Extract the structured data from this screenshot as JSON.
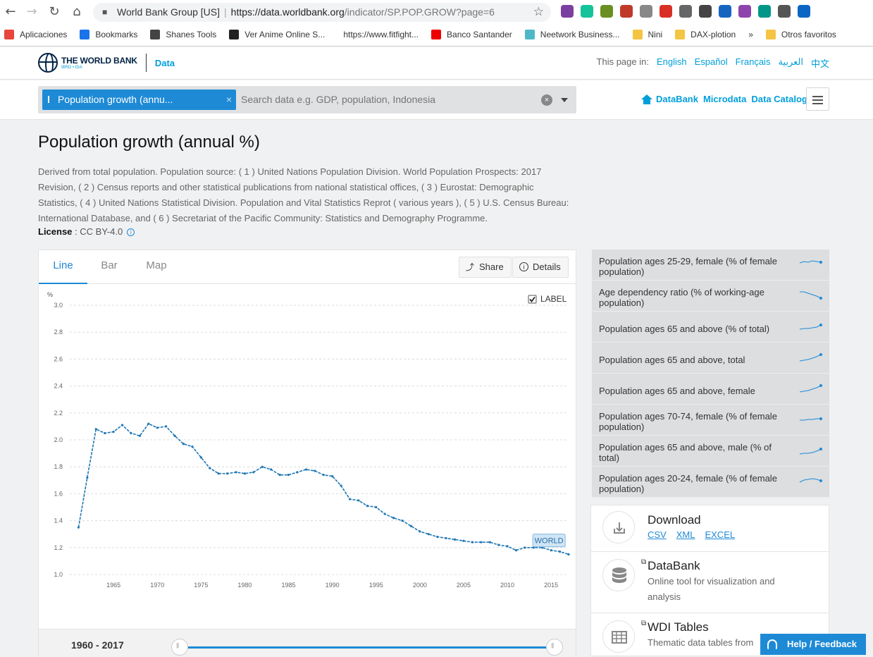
{
  "browser": {
    "tab_title": "World Bank Group [US]",
    "url_host": "https://data.worldbank.org",
    "url_path": "/indicator/SP.POP.GROW?page=6",
    "bookmarks": [
      {
        "label": "Aplicaciones",
        "color": "#e8453c"
      },
      {
        "label": "Bookmarks",
        "color": "#1a73e8"
      },
      {
        "label": "Shanes Tools",
        "color": "#444444"
      },
      {
        "label": "Ver Anime Online S...",
        "color": "#222222"
      },
      {
        "label": "https://www.fitfight...",
        "color": "#ffffff"
      },
      {
        "label": "Banco Santander",
        "color": "#ec0000"
      },
      {
        "label": "Neetwork Business...",
        "color": "#4fb8c8"
      },
      {
        "label": "Nini",
        "color": "#f4c542"
      },
      {
        "label": "DAX-plotion",
        "color": "#f4c542"
      }
    ],
    "bookmarks_more": "»",
    "bookmarks_other": "Otros favoritos",
    "ext_colors": [
      "#7b3fa0",
      "#15c39a",
      "#6b8e23",
      "#c0392b",
      "#888888",
      "#d93025",
      "#666666",
      "#444444",
      "#1565c0",
      "#8e44ad",
      "#009688",
      "#555555",
      "#0a66c2"
    ]
  },
  "header": {
    "logo_line1": "THE WORLD BANK",
    "logo_line2": "IBRD • IDA",
    "section": "Data",
    "lang_label": "This page in:",
    "languages": [
      "English",
      "Español",
      "Français",
      "العربية",
      "中文"
    ]
  },
  "search": {
    "chip_label": "Population growth (annu...",
    "chip_close": "×",
    "placeholder": "Search data e.g. GDP, population, Indonesia",
    "links": [
      "DataBank",
      "Microdata",
      "Data Catalog"
    ]
  },
  "page": {
    "title": "Population growth (annual %)",
    "description": "Derived from total population. Population source: ( 1 ) United Nations Population Division. World Population Prospects: 2017 Revision, ( 2 ) Census reports and other statistical publications from national statistical offices, ( 3 ) Eurostat: Demographic Statistics, ( 4 ) United Nations Statistical Division. Population and Vital Statistics Reprot ( various years ), ( 5 ) U.S. Census Bureau: International Database, and ( 6 ) Secretariat of the Pacific Community: Statistics and Demography Programme.",
    "license_label": "License",
    "license_value": " : CC BY-4.0"
  },
  "chart_panel": {
    "tabs": [
      "Line",
      "Bar",
      "Map"
    ],
    "active_tab": "Line",
    "share_label": "Share",
    "details_label": "Details",
    "label_toggle": "LABEL",
    "label_checked": true,
    "range_start": "1960",
    "range_sep": " - ",
    "range_end": "2017"
  },
  "chart_data": {
    "type": "line",
    "ylabel": "%",
    "ylim": [
      1.0,
      3.0
    ],
    "yticks": [
      "1.0",
      "1.2",
      "1.4",
      "1.6",
      "1.8",
      "2.0",
      "2.2",
      "2.4",
      "2.6",
      "2.8",
      "3.0"
    ],
    "xlim": [
      1960,
      2017
    ],
    "xticks": [
      "1965",
      "1970",
      "1975",
      "1980",
      "1985",
      "1990",
      "1995",
      "2000",
      "2005",
      "2010",
      "2015"
    ],
    "grid": true,
    "line_color": "#1f77b4",
    "series": [
      {
        "name": "WORLD",
        "x": [
          1961,
          1962,
          1963,
          1964,
          1965,
          1966,
          1967,
          1968,
          1969,
          1970,
          1971,
          1972,
          1973,
          1974,
          1975,
          1976,
          1977,
          1978,
          1979,
          1980,
          1981,
          1982,
          1983,
          1984,
          1985,
          1986,
          1987,
          1988,
          1989,
          1990,
          1991,
          1992,
          1993,
          1994,
          1995,
          1996,
          1997,
          1998,
          1999,
          2000,
          2001,
          2002,
          2003,
          2004,
          2005,
          2006,
          2007,
          2008,
          2009,
          2010,
          2011,
          2012,
          2013,
          2014,
          2015,
          2016,
          2017
        ],
        "values": [
          1.35,
          1.72,
          2.08,
          2.05,
          2.06,
          2.11,
          2.05,
          2.03,
          2.12,
          2.09,
          2.1,
          2.03,
          1.97,
          1.95,
          1.87,
          1.79,
          1.75,
          1.75,
          1.76,
          1.75,
          1.76,
          1.8,
          1.78,
          1.74,
          1.74,
          1.76,
          1.78,
          1.77,
          1.74,
          1.73,
          1.66,
          1.56,
          1.55,
          1.51,
          1.5,
          1.45,
          1.42,
          1.4,
          1.36,
          1.32,
          1.3,
          1.28,
          1.27,
          1.26,
          1.25,
          1.24,
          1.24,
          1.24,
          1.22,
          1.21,
          1.18,
          1.2,
          1.2,
          1.2,
          1.18,
          1.17,
          1.15
        ]
      }
    ]
  },
  "related": [
    {
      "label": "Population ages 25-29, female (% of female population)",
      "spark": [
        5,
        3,
        4,
        2,
        3,
        4
      ]
    },
    {
      "label": "Age dependency ratio (% of working-age population)",
      "spark": [
        2,
        2,
        4,
        6,
        8,
        11
      ]
    },
    {
      "label": "Population ages 65 and above (% of total)",
      "spark": [
        11,
        10,
        10,
        9,
        8,
        5
      ]
    },
    {
      "label": "Population ages 65 and above, total",
      "spark": [
        12,
        11,
        10,
        8,
        6,
        3
      ]
    },
    {
      "label": "Population ages 65 and above, female",
      "spark": [
        12,
        11,
        10,
        8,
        6,
        3
      ]
    },
    {
      "label": "Population ages 70-74, female (% of female population)",
      "spark": [
        8,
        8,
        7,
        7,
        6,
        6
      ]
    },
    {
      "label": "Population ages 65 and above, male (% of total)",
      "spark": [
        12,
        11,
        11,
        10,
        8,
        5
      ]
    },
    {
      "label": "Population ages 20-24, female (% of female population)",
      "spark": [
        8,
        5,
        4,
        3,
        4,
        6
      ]
    }
  ],
  "downloads": {
    "title": "Download",
    "formats": [
      "CSV",
      "XML",
      "EXCEL"
    ]
  },
  "databank": {
    "title": "DataBank",
    "subtitle": "Online tool for visualization and analysis"
  },
  "wdi": {
    "title": "WDI Tables",
    "subtitle": "Thematic data tables from"
  },
  "help": {
    "label": "Help / Feedback"
  }
}
